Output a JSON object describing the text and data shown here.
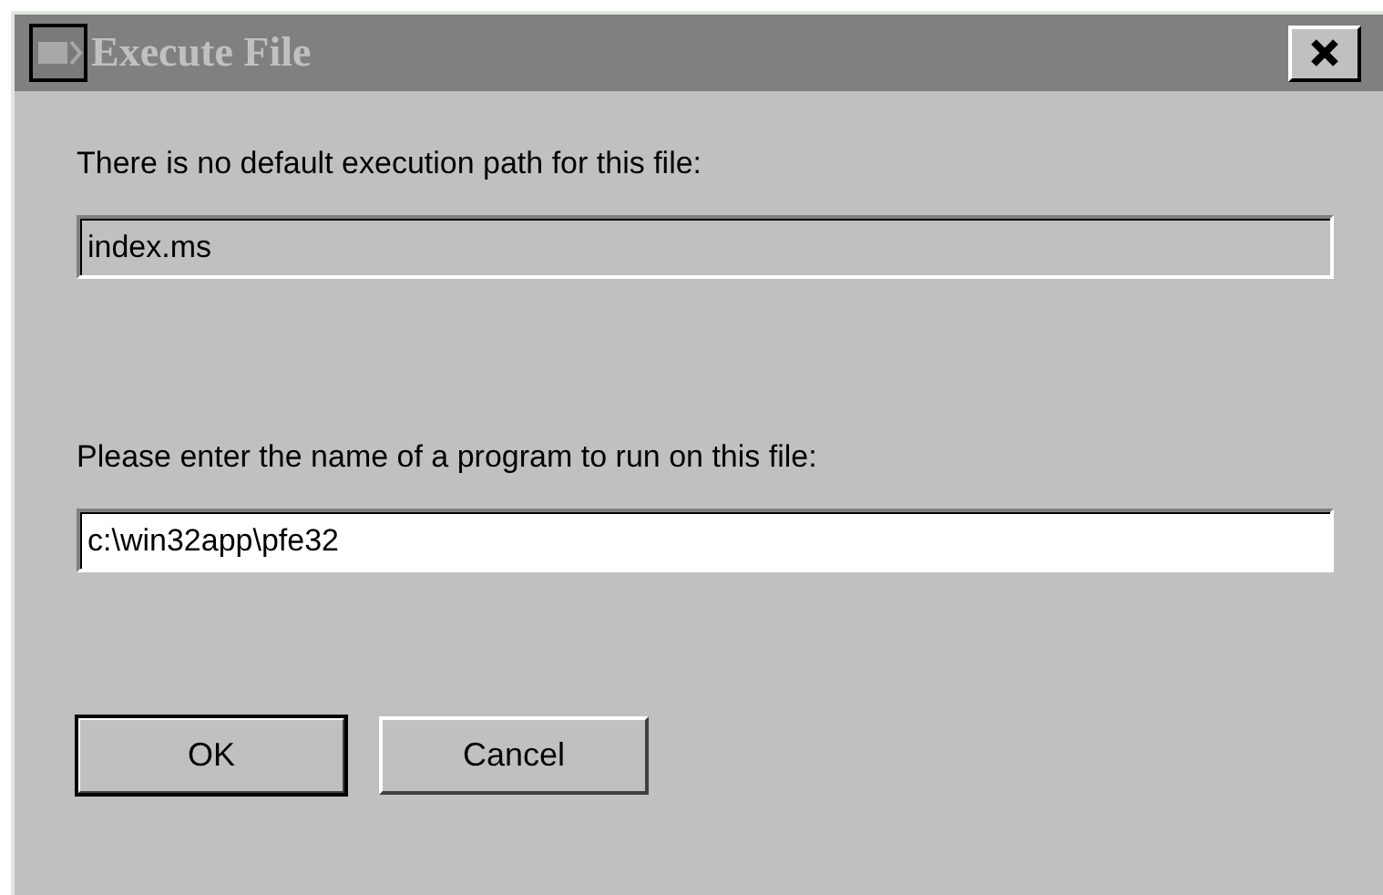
{
  "window": {
    "title": "Execute File",
    "active": false
  },
  "fields": [
    {
      "label": "There is no default execution path for this file:",
      "value": "index.ms",
      "disabled": true
    },
    {
      "label": "Please enter the name of a program to run on this file:",
      "value": "c:\\win32app\\pfe32",
      "disabled": false
    }
  ],
  "buttons": [
    {
      "label": "OK",
      "default": true
    },
    {
      "label": "Cancel",
      "default": false
    }
  ]
}
